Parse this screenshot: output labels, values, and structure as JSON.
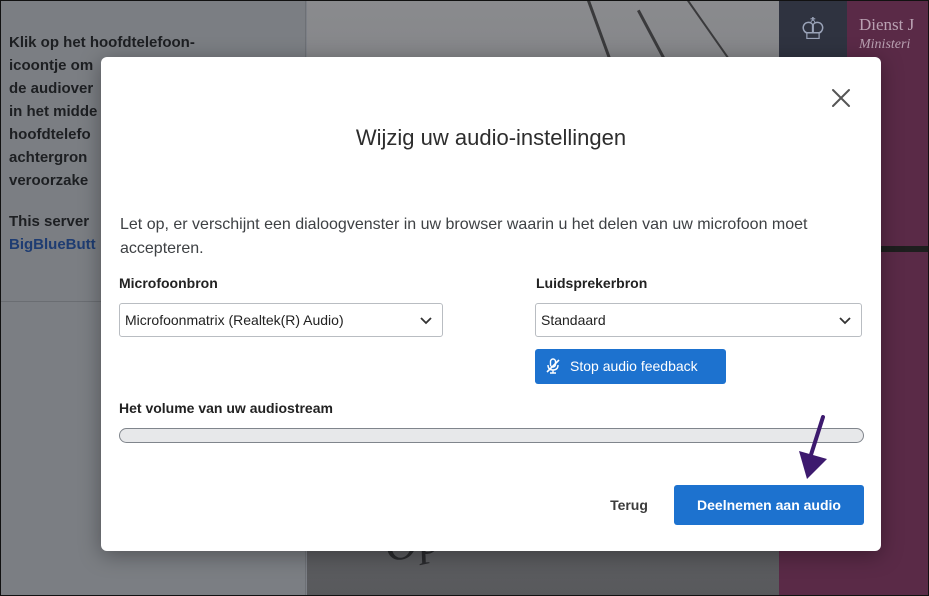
{
  "background": {
    "instructions": [
      "Klik op het hoofdtelefoon-",
      "icoontje om",
      "de audiover",
      "in het midde",
      "hoofdtelefo",
      "achtergron",
      "veroorzake"
    ],
    "server_note": [
      "This server",
      "BigBlueButt"
    ],
    "ministry": [
      "Dienst J",
      "Ministeri"
    ],
    "slide_text": "Opleid"
  },
  "dialog": {
    "title": "Wijzig uw audio-instellingen",
    "close_icon": "close-icon",
    "notice": "Let op, er verschijnt een dialoogvenster in uw browser waarin u het delen van uw microfoon moet accepteren.",
    "microphone": {
      "label": "Microfoonbron",
      "selected": "Microfoonmatrix (Realtek(R) Audio)"
    },
    "speaker": {
      "label": "Luidsprekerbron",
      "selected": "Standaard"
    },
    "stop_feedback_button": "Stop audio feedback",
    "stop_feedback_icon": "microphone-off-icon",
    "volume": {
      "label": "Het volume van uw audiostream",
      "level": 0
    },
    "back_button": "Terug",
    "join_button": "Deelnemen aan audio"
  },
  "colors": {
    "primary": "#1d72cf",
    "annotation_arrow": "#3d1a6e"
  }
}
